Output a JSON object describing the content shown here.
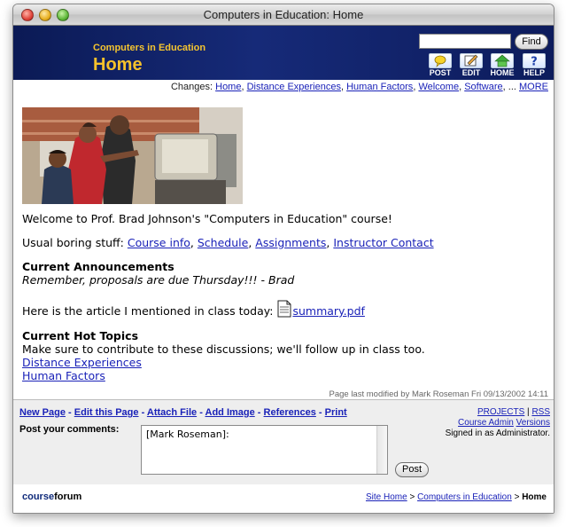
{
  "window": {
    "title": "Computers in Education: Home"
  },
  "banner": {
    "site_name": "Computers in Education",
    "page_title": "Home",
    "search_placeholder": "",
    "find_label": "Find",
    "toolbar": [
      {
        "label": "POST",
        "icon": "post-icon"
      },
      {
        "label": "EDIT",
        "icon": "edit-icon"
      },
      {
        "label": "HOME",
        "icon": "home-icon"
      },
      {
        "label": "HELP",
        "icon": "help-icon"
      }
    ]
  },
  "changes": {
    "label": "Changes:",
    "links": [
      "Home",
      "Distance Experiences",
      "Human Factors",
      "Welcome",
      "Software"
    ],
    "ellipsis": "...",
    "more": "MORE"
  },
  "content": {
    "welcome": "Welcome to Prof. Brad Johnson's \"Computers in Education\" course!",
    "usual_label": "Usual boring stuff:",
    "usual_links": [
      "Course info",
      "Schedule",
      "Assignments",
      "Instructor Contact"
    ],
    "announcements_heading": "Current Announcements",
    "announcement": "Remember, proposals are due Thursday!!! - Brad",
    "article_text": "Here is the article I mentioned in class today:",
    "article_file": "summary.pdf",
    "hot_topics_heading": "Current Hot Topics",
    "hot_topics_text": "Make sure to contribute to these discussions; we'll follow up in class too.",
    "hot_topics_links": [
      "Distance Experiences",
      "Human Factors"
    ]
  },
  "modified": "Page last modified by Mark Roseman Fri 09/13/2002 14:11",
  "actions": [
    "New Page",
    "Edit this Page",
    "Attach File",
    "Add Image",
    "References",
    "Print"
  ],
  "comments": {
    "label": "Post your comments:",
    "value": "[Mark Roseman]:",
    "post_label": "Post"
  },
  "admin": {
    "projects": "PROJECTS",
    "rss": "RSS",
    "course_admin": "Course Admin",
    "versions": "Versions",
    "signed_in": "Signed in as Administrator."
  },
  "footer": {
    "brand_part1": "course",
    "brand_part2": "forum",
    "breadcrumb": [
      "Site Home",
      "Computers in Education",
      "Home"
    ]
  }
}
